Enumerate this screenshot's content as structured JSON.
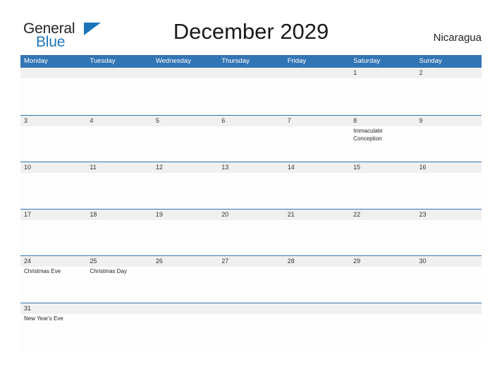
{
  "brand": {
    "logo_text_1": "General",
    "logo_text_2": "Blue",
    "logo_icon": "blue-flag-triangle",
    "logo_color_primary": "#1b75bb",
    "logo_color_secondary": "#231f20"
  },
  "header": {
    "title": "December 2029",
    "country": "Nicaragua"
  },
  "theme": {
    "header_blue": "#3275b4",
    "row_rule_blue": "#3275b4",
    "dateband_gray": "#f0f0f0",
    "page_background": "#ffffff",
    "day_number_color": "#333333",
    "event_text_color": "#262626"
  },
  "calendar": {
    "month": "December",
    "year": "2029",
    "weekday_headers": [
      "Monday",
      "Tuesday",
      "Wednesday",
      "Thursday",
      "Friday",
      "Saturday",
      "Sunday"
    ],
    "weeks": [
      {
        "days": [
          {
            "num": "",
            "events": []
          },
          {
            "num": "",
            "events": []
          },
          {
            "num": "",
            "events": []
          },
          {
            "num": "",
            "events": []
          },
          {
            "num": "",
            "events": []
          },
          {
            "num": "1",
            "events": []
          },
          {
            "num": "2",
            "events": []
          }
        ]
      },
      {
        "days": [
          {
            "num": "3",
            "events": []
          },
          {
            "num": "4",
            "events": []
          },
          {
            "num": "5",
            "events": []
          },
          {
            "num": "6",
            "events": []
          },
          {
            "num": "7",
            "events": []
          },
          {
            "num": "8",
            "events": [
              "Immaculate",
              "Conception"
            ]
          },
          {
            "num": "9",
            "events": []
          }
        ]
      },
      {
        "days": [
          {
            "num": "10",
            "events": []
          },
          {
            "num": "11",
            "events": []
          },
          {
            "num": "12",
            "events": []
          },
          {
            "num": "13",
            "events": []
          },
          {
            "num": "14",
            "events": []
          },
          {
            "num": "15",
            "events": []
          },
          {
            "num": "16",
            "events": []
          }
        ]
      },
      {
        "days": [
          {
            "num": "17",
            "events": []
          },
          {
            "num": "18",
            "events": []
          },
          {
            "num": "19",
            "events": []
          },
          {
            "num": "20",
            "events": []
          },
          {
            "num": "21",
            "events": []
          },
          {
            "num": "22",
            "events": []
          },
          {
            "num": "23",
            "events": []
          }
        ]
      },
      {
        "days": [
          {
            "num": "24",
            "events": [
              "Christmas Eve"
            ]
          },
          {
            "num": "25",
            "events": [
              "Christmas Day"
            ]
          },
          {
            "num": "26",
            "events": []
          },
          {
            "num": "27",
            "events": []
          },
          {
            "num": "28",
            "events": []
          },
          {
            "num": "29",
            "events": []
          },
          {
            "num": "30",
            "events": []
          }
        ]
      },
      {
        "days": [
          {
            "num": "31",
            "events": [
              "New Year's Eve"
            ]
          },
          {
            "num": "",
            "events": []
          },
          {
            "num": "",
            "events": []
          },
          {
            "num": "",
            "events": []
          },
          {
            "num": "",
            "events": []
          },
          {
            "num": "",
            "events": []
          },
          {
            "num": "",
            "events": []
          }
        ]
      }
    ]
  }
}
